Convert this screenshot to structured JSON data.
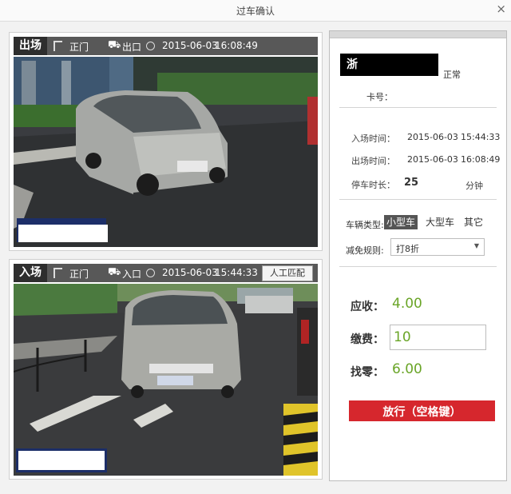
{
  "window": {
    "title": "过车确认",
    "close_glyph": "×"
  },
  "exit_panel": {
    "tag": "出场",
    "gate": "正门",
    "direction": "出口",
    "date": "2015-06-03",
    "time": "16:08:49"
  },
  "entry_panel": {
    "tag": "入场",
    "gate": "正门",
    "direction": "入口",
    "date": "2015-06-03",
    "time": "15:44:33",
    "manual_match": "人工匹配"
  },
  "info": {
    "plate": "浙",
    "status": "正常",
    "card_label": "卡号：",
    "entry_time_label": "入场时间：",
    "entry_date": "2015-06-03",
    "entry_time": "15:44:33",
    "exit_time_label": "出场时间：",
    "exit_date": "2015-06-03",
    "exit_time": "16:08:49",
    "duration_label": "停车时长：",
    "duration_value": "25",
    "duration_unit": "分钟",
    "vehicle_type_label": "车辆类型:",
    "vehicle_types": [
      "小型车",
      "大型车",
      "其它"
    ],
    "discount_label": "减免规则:",
    "discount_value": "打8折",
    "receivable_label": "应收：",
    "receivable_value": "4.00",
    "paid_label": "缴费：",
    "paid_value": "10",
    "change_label": "找零：",
    "change_value": "6.00",
    "release_button": "放行（空格键）"
  },
  "colors": {
    "accent_green": "#6aa528",
    "release_red": "#d6272d",
    "bar_dark": "#585858"
  },
  "icons": [
    "gate-icon",
    "car-icon",
    "clock-icon",
    "dropdown-arrow-icon",
    "close-icon"
  ]
}
